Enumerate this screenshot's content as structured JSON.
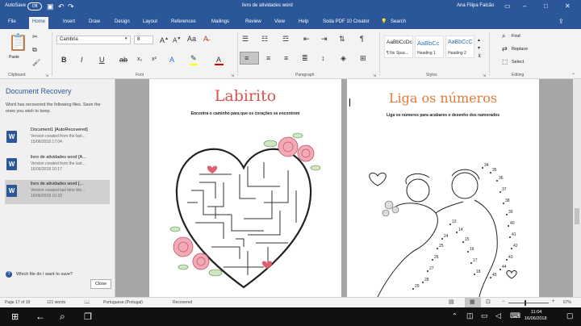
{
  "window": {
    "title": "livro de atividades word",
    "autosave": "AutoSave",
    "autosave_state": "Off",
    "user": "Ana Filipa Falcão"
  },
  "tabs": [
    "File",
    "Home",
    "Insert",
    "Draw",
    "Design",
    "Layout",
    "References",
    "Mailings",
    "Review",
    "View",
    "Help",
    "Soda PDF 10 Creator"
  ],
  "active_tab": "Home",
  "tell_me": "Search",
  "ribbon": {
    "clipboard": {
      "label": "Clipboard",
      "paste": "Paste"
    },
    "font": {
      "label": "Font",
      "name": "Cambria",
      "size": "8"
    },
    "paragraph": {
      "label": "Paragraph"
    },
    "styles": {
      "label": "Styles",
      "items": [
        {
          "preview": "AaBbCcDc",
          "name": "¶ No Spac..."
        },
        {
          "preview": "AaBbCc",
          "name": "Heading 1"
        },
        {
          "preview": "AaBbCcC",
          "name": "Heading 2"
        }
      ]
    },
    "editing": {
      "label": "Editing",
      "find": "Find",
      "replace": "Replace",
      "select": "Select"
    }
  },
  "recovery": {
    "title": "Document Recovery",
    "description": "Word has recovered the following files. Save the ones you wish to keep.",
    "items": [
      {
        "name": "Document1 [AutoRecovered]",
        "line2": "Version created from the last...",
        "line3": "15/06/2018 17:04"
      },
      {
        "name": "livro de atividades word [A...",
        "line2": "Version created from the last...",
        "line3": "16/06/2018 10:17"
      },
      {
        "name": "livro de atividades word [...",
        "line2": "Version created last time the...",
        "line3": "16/06/2018 10:33"
      }
    ],
    "help": "Which file do I want to save?",
    "close": "Close"
  },
  "pages": {
    "left": {
      "title": "Labirito",
      "subtitle": "Encontra o caminho para que os corações se encontrem"
    },
    "right": {
      "title": "Liga os números",
      "subtitle": "Liga os números para acabares o desenho dos namorados"
    }
  },
  "status": {
    "page": "Page 17 of 18",
    "words": "121 words",
    "language": "Portuguese (Portugal)",
    "state": "Recovered",
    "zoom": "67%"
  },
  "taskbar": {
    "time": "11:04",
    "date": "16/06/2018"
  },
  "colors": {
    "word_blue": "#2b579a",
    "left_title": "#d9534f",
    "right_title": "#e07b39"
  }
}
